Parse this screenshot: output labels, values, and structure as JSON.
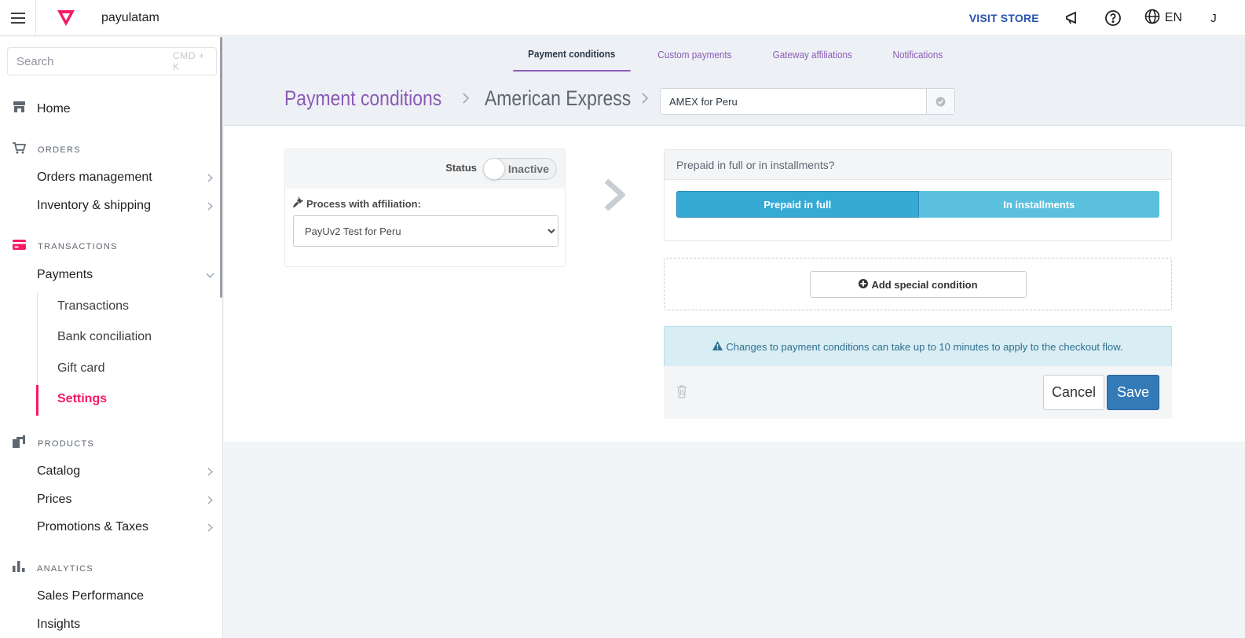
{
  "topbar": {
    "account_name": "payulatam",
    "visit_store": "VISIT STORE",
    "language": "EN",
    "user_initial": "J",
    "brand_color": "#f71963"
  },
  "sidebar": {
    "search_placeholder": "Search",
    "search_shortcut": "CMD + K",
    "home_label": "Home",
    "sections": {
      "orders": "ORDERS",
      "transactions": "TRANSACTIONS",
      "products": "PRODUCTS",
      "analytics": "ANALYTICS"
    },
    "items": {
      "orders_management": "Orders management",
      "inventory_shipping": "Inventory & shipping",
      "payments": "Payments",
      "catalog": "Catalog",
      "prices": "Prices",
      "promotions_taxes": "Promotions & Taxes",
      "sales_performance": "Sales Performance",
      "insights": "Insights"
    },
    "payments_sub": {
      "transactions": "Transactions",
      "bank_conciliation": "Bank conciliation",
      "gift_card": "Gift card",
      "settings": "Settings"
    },
    "active_sub_item": "Settings"
  },
  "tabs": {
    "payment_conditions": "Payment conditions",
    "custom_payments": "Custom payments",
    "gateway_affiliations": "Gateway affiliations",
    "notifications": "Notifications",
    "active": "Payment conditions"
  },
  "breadcrumb": {
    "root": "Payment conditions",
    "method": "American Express",
    "rule_name": "AMEX for Peru"
  },
  "status": {
    "label": "Status",
    "toggle_state": "Inactive"
  },
  "affiliation": {
    "label": "Process with affiliation:",
    "selected": "PayUv2 Test for Peru"
  },
  "payment_type": {
    "question": "Prepaid in full or in installments?",
    "option_full": "Prepaid in full",
    "option_installments": "In installments",
    "selected": "Prepaid in full"
  },
  "special_condition": {
    "button_label": "Add special condition"
  },
  "notice": {
    "text": "Changes to payment conditions can take up to 10 minutes to apply to the checkout flow."
  },
  "actions": {
    "cancel": "Cancel",
    "save": "Save"
  }
}
